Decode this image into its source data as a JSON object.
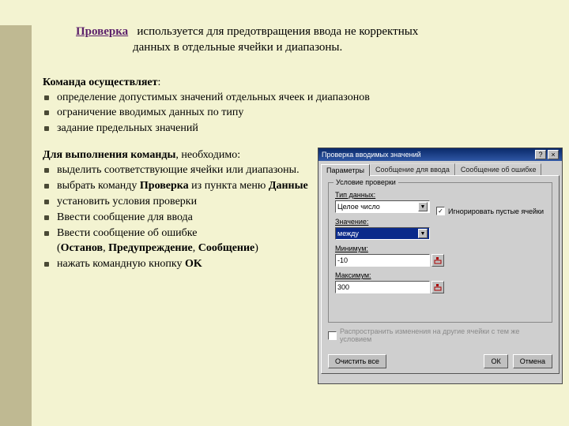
{
  "title": {
    "link": "Проверка",
    "desc1": "используется для предотвращения ввода не корректных",
    "desc2": "данных в отдельные ячейки и диапазоны."
  },
  "section1": {
    "head": "Команда осуществляет",
    "items": [
      " определение допустимых значений отдельных ячеек и  диапазонов",
      "ограничение вводимых данных по типу",
      "задание предельных значений"
    ]
  },
  "section2": {
    "head_a": "Для выполнения команды",
    "head_b": ", необходимо:",
    "items": [
      {
        "t": "выделить соответствующие ячейки или диапазоны."
      },
      {
        "pre": "выбрать команду ",
        "b1": "Проверка",
        "mid": " из пункта меню ",
        "b2": "Данные"
      },
      {
        "t": "установить условия проверки"
      },
      {
        "t": "Ввести сообщение для ввода"
      },
      {
        "t": "Ввести сообщение об ошибке"
      },
      {
        "paren": "(",
        "b1": "Останов",
        "c1": ", ",
        "b2": "Предупреждение",
        "c2": ", ",
        "b3": "Сообщение",
        "close": ")"
      },
      {
        "pre": "нажать командную кнопку ",
        "b1": "OK"
      }
    ]
  },
  "dlg": {
    "title": "Проверка вводимых значений",
    "tabs": [
      "Параметры",
      "Сообщение для ввода",
      "Сообщение об ошибке"
    ],
    "group": "Условие проверки",
    "f1": {
      "label": "Тип данных:",
      "value": "Целое число"
    },
    "chk_ignore": "Игнорировать пустые ячейки",
    "f2": {
      "label": "Значение:",
      "value": "между"
    },
    "f3": {
      "label": "Минимум:",
      "value": "-10"
    },
    "f4": {
      "label": "Максимум:",
      "value": "300"
    },
    "chk_spread": "Распространить изменения на другие ячейки с тем же условием",
    "btn_clear": "Очистить все",
    "btn_ok": "ОК",
    "btn_cancel": "Отмена"
  }
}
